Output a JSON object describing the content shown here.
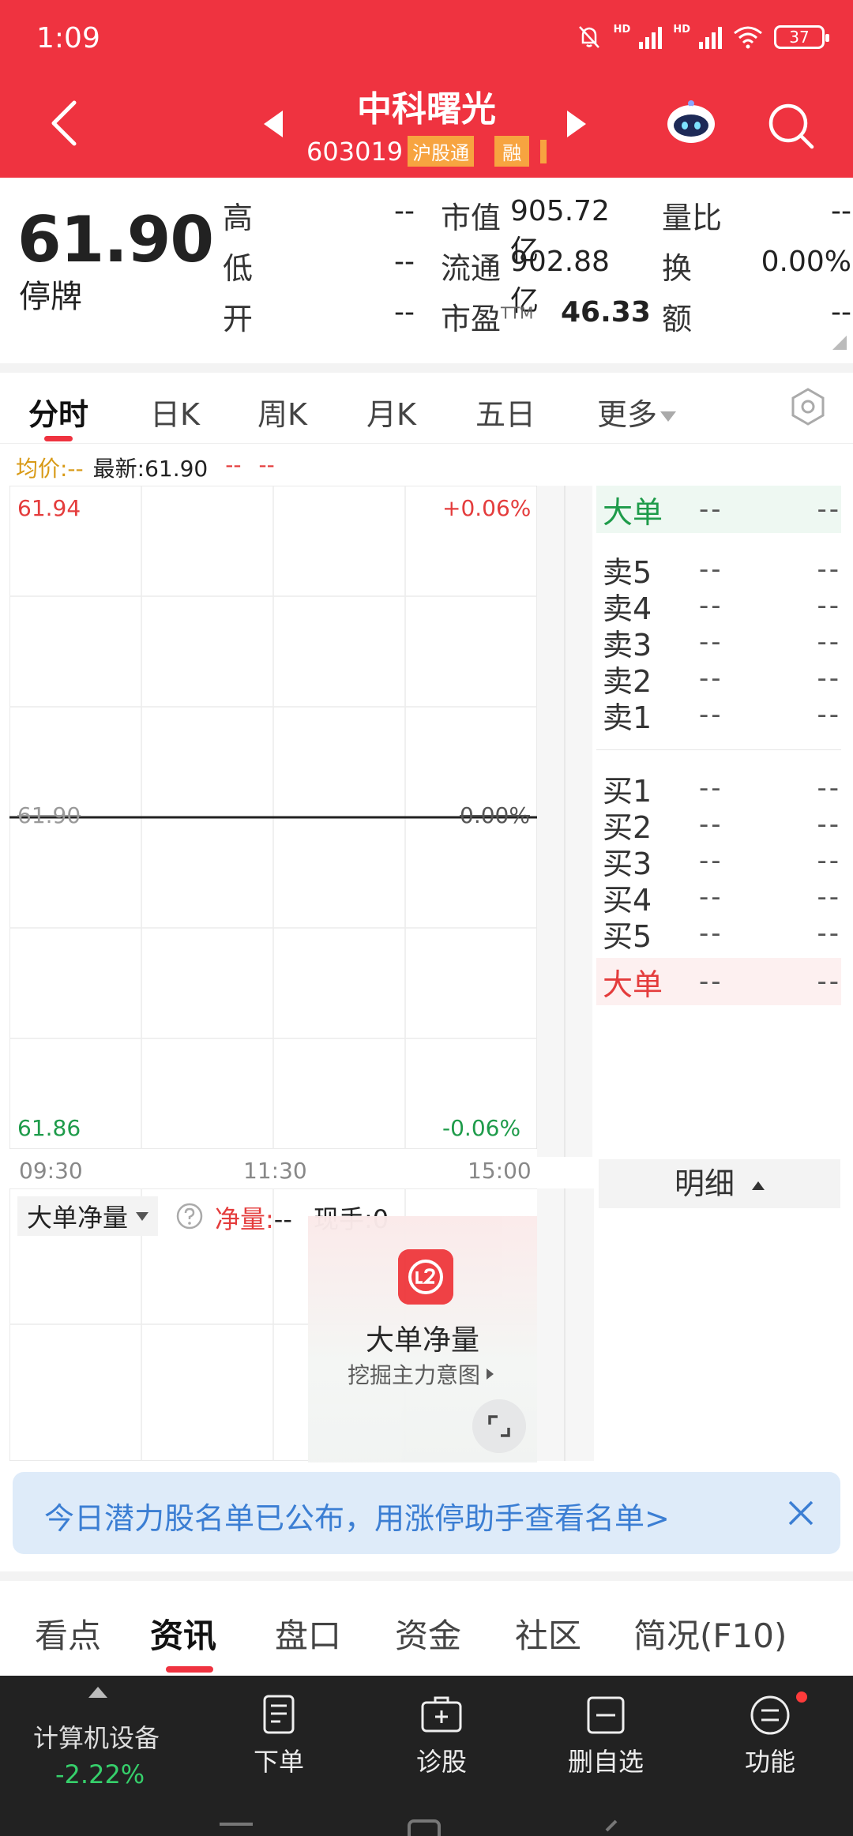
{
  "status_bar": {
    "time": "1:09",
    "hd1": "HD",
    "hd2": "HD",
    "battery": "37"
  },
  "header": {
    "stock_name": "中科曙光",
    "stock_code": "603019",
    "tag_hgt": "沪股通",
    "tag_rong": "融"
  },
  "quote": {
    "price": "61.90",
    "status": "停牌",
    "high_label": "高",
    "high_value": "--",
    "low_label": "低",
    "low_value": "--",
    "open_label": "开",
    "open_value": "--",
    "mcap_label": "市值",
    "mcap_value": "905.72亿",
    "float_label": "流通",
    "float_value": "902.88亿",
    "pe_label": "市盈",
    "pe_sup": "TTM",
    "pe_value": "46.33",
    "volratio_label": "量比",
    "volratio_value": "--",
    "turnover_label": "换",
    "turnover_value": "0.00%",
    "amount_label": "额",
    "amount_value": "--"
  },
  "chart_tabs": [
    "分时",
    "日K",
    "周K",
    "月K",
    "五日",
    "更多"
  ],
  "info_line": {
    "avg": "均价:--",
    "latest": "最新:61.90",
    "d1": "--",
    "d2": "--"
  },
  "chart_data": {
    "type": "line",
    "x_ticks": [
      "09:30",
      "11:30",
      "15:00"
    ],
    "y_left": {
      "top": "61.94",
      "mid": "61.90",
      "bottom": "61.86"
    },
    "y_right": {
      "top": "+0.06%",
      "mid": "0.00%",
      "bottom": "-0.06%"
    },
    "ylim": [
      61.86,
      61.94
    ],
    "series": [
      {
        "values": [
          61.9,
          61.9
        ]
      }
    ]
  },
  "orderbook": {
    "big_top": {
      "label": "大单",
      "price": "--",
      "vol": "--"
    },
    "sell": [
      {
        "label": "卖5",
        "price": "--",
        "vol": "--"
      },
      {
        "label": "卖4",
        "price": "--",
        "vol": "--"
      },
      {
        "label": "卖3",
        "price": "--",
        "vol": "--"
      },
      {
        "label": "卖2",
        "price": "--",
        "vol": "--"
      },
      {
        "label": "卖1",
        "price": "--",
        "vol": "--"
      }
    ],
    "buy": [
      {
        "label": "买1",
        "price": "--",
        "vol": "--"
      },
      {
        "label": "买2",
        "price": "--",
        "vol": "--"
      },
      {
        "label": "买3",
        "price": "--",
        "vol": "--"
      },
      {
        "label": "买4",
        "price": "--",
        "vol": "--"
      },
      {
        "label": "买5",
        "price": "--",
        "vol": "--"
      }
    ],
    "big_bottom": {
      "label": "大单",
      "price": "--",
      "vol": "--"
    },
    "detail_label": "明细"
  },
  "sub_panel": {
    "selector": "大单净量",
    "net_label": "净量:",
    "net_value": "--",
    "hand_label": "现手:0",
    "promo_title": "大单净量",
    "promo_sub": "挖掘主力意图"
  },
  "banner": {
    "text": "今日潜力股名单已公布，用涨停助手查看名单>"
  },
  "info_tabs": [
    "看点",
    "资讯",
    "盘口",
    "资金",
    "社区",
    "简况(F10)"
  ],
  "toolbar": {
    "sector": "计算机设备",
    "sector_change": "-2.22%",
    "items": [
      "下单",
      "诊股",
      "删自选",
      "功能"
    ]
  },
  "colors": {
    "brand_red": "#ef3340",
    "up_red": "#e43c3c",
    "down_green": "#1e9b4a",
    "toolbar_bg": "#222222"
  }
}
